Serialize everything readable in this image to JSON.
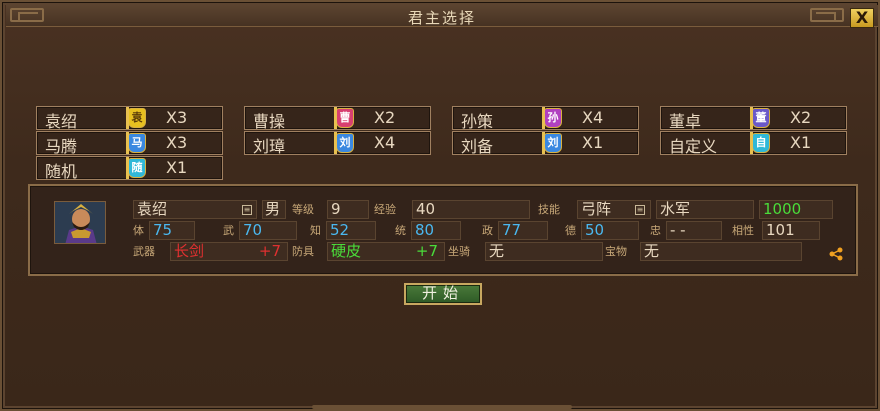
{
  "title": "君主选择",
  "close_icon": "X",
  "lords": [
    {
      "name": "袁绍",
      "badge": "袁",
      "count": "X3",
      "color": "#e8c020",
      "text": "#5a3a08"
    },
    {
      "name": "曹操",
      "badge": "曹",
      "count": "X2",
      "color": "#d84070",
      "text": "#ffffff"
    },
    {
      "name": "孙策",
      "badge": "孙",
      "count": "X4",
      "color": "#b040c0",
      "text": "#ffffff"
    },
    {
      "name": "董卓",
      "badge": "董",
      "count": "X2",
      "color": "#6a58c8",
      "text": "#ffffff"
    },
    {
      "name": "马腾",
      "badge": "马",
      "count": "X3",
      "color": "#3a88e0",
      "text": "#ffffff"
    },
    {
      "name": "刘璋",
      "badge": "刘",
      "count": "X4",
      "color": "#3a88e0",
      "text": "#ffffff"
    },
    {
      "name": "刘备",
      "badge": "刘",
      "count": "X1",
      "color": "#3a88e0",
      "text": "#ffffff"
    },
    {
      "name": "自定义",
      "badge": "自",
      "count": "X1",
      "color": "#30b8d8",
      "text": "#ffffff"
    },
    {
      "name": "随机",
      "badge": "随",
      "count": "X1",
      "color": "#30b8d8",
      "text": "#ffffff"
    }
  ],
  "general": {
    "name": "袁绍",
    "gender": "男",
    "level_label": "等级",
    "level": "9",
    "exp_label": "经验",
    "exp": "40",
    "skill_label": "技能",
    "skill": "弓阵",
    "troop": "水军",
    "troop_count": "1000",
    "stats": [
      {
        "label": "体",
        "value": "75"
      },
      {
        "label": "武",
        "value": "70"
      },
      {
        "label": "知",
        "value": "52"
      },
      {
        "label": "统",
        "value": "80"
      },
      {
        "label": "政",
        "value": "77"
      },
      {
        "label": "德",
        "value": "50"
      },
      {
        "label": "忠",
        "value": "- -"
      },
      {
        "label": "相性",
        "value": "101"
      }
    ],
    "weapon_label": "武器",
    "weapon": "长剑",
    "weapon_bonus": "+7",
    "armor_label": "防具",
    "armor": "硬皮",
    "armor_bonus": "+7",
    "mount_label": "坐骑",
    "mount": "无",
    "treasure_label": "宝物",
    "treasure": "无"
  },
  "start_button": "开始"
}
